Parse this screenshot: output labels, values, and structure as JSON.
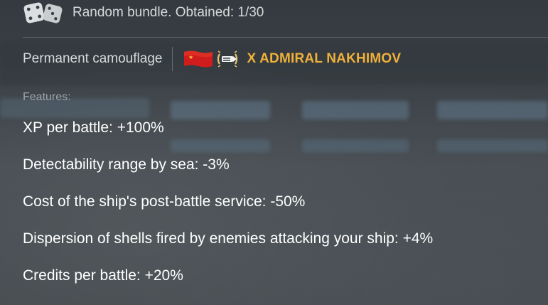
{
  "header": {
    "icon": "dice-icon",
    "text": "Random bundle. Obtained: 1/30"
  },
  "camouflage": {
    "label": "Permanent camouflage",
    "flag_icon": "ussr-flag-icon",
    "class_icon": "destroyer-class-icon",
    "ship_name": "X ADMIRAL NAKHIMOV",
    "ship_name_color": "#f0b13a"
  },
  "features": {
    "label": "Features:",
    "items": [
      "XP per battle: +100%",
      "Detectability range by sea: -3%",
      "Cost of the ship's post-battle service: -50%",
      "Dispersion of shells fired by enemies attacking your ship: +4%",
      "Credits per battle: +20%"
    ]
  }
}
